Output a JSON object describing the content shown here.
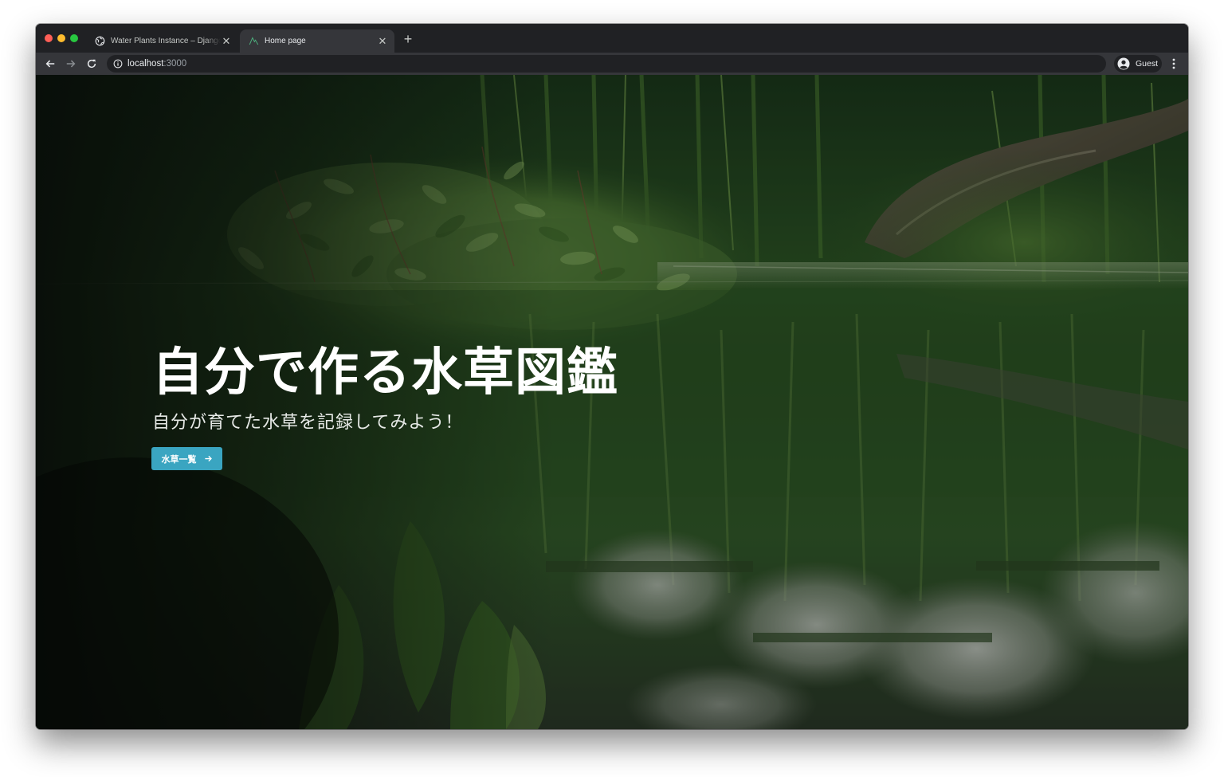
{
  "browser": {
    "tabs": [
      {
        "title": "Water Plants Instance – Django R",
        "active": false,
        "icon": "globe-icon"
      },
      {
        "title": "Home page",
        "active": true,
        "icon": "site-logo-icon"
      }
    ],
    "address_bar": {
      "host": "localhost",
      "port": ":3000"
    },
    "profile": {
      "name": "Guest",
      "icon": "account-circle-icon"
    }
  },
  "hero": {
    "title": "自分で作る水草図鑑",
    "subtitle": "自分が育てた水草を記録してみよう！",
    "cta_label": "水草一覧",
    "cta_icon": "arrow-right-icon",
    "accent_color": "#3aa5c1"
  }
}
